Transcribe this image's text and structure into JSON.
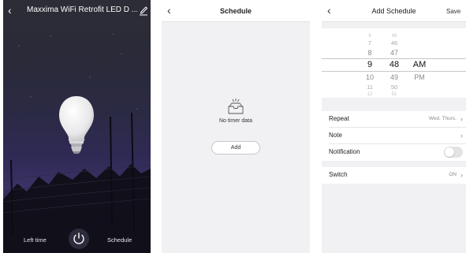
{
  "device_panel": {
    "title": "Maxxima WiFi Retrofit LED D ...",
    "left_time_label": "Left time",
    "schedule_label": "Schedule"
  },
  "schedule_panel": {
    "title": "Schedule",
    "empty_text": "No timer data",
    "add_label": "Add"
  },
  "add_schedule_panel": {
    "title": "Add Schedule",
    "save_label": "Save",
    "picker": {
      "hours": [
        "6",
        "7",
        "8",
        "9",
        "10",
        "11",
        "12"
      ],
      "minutes": [
        "45",
        "46",
        "47",
        "48",
        "49",
        "50",
        "51"
      ],
      "periods": [
        "AM",
        "PM"
      ],
      "selected": {
        "hour": "9",
        "minute": "48",
        "period": "AM"
      }
    },
    "rows": {
      "repeat": {
        "label": "Repeat",
        "value": "Wed. Thurs."
      },
      "note": {
        "label": "Note",
        "value": ""
      },
      "notification": {
        "label": "Notification",
        "on": false
      },
      "switch": {
        "label": "Switch",
        "value": "ON"
      }
    }
  },
  "colors": {
    "sky_top": "#2c2d36",
    "sky_purple": "#3b3266",
    "panel_bg": "#f1f1f3",
    "toggle_off": "#e3e3e6"
  },
  "icons": {
    "back": "chevron-left-icon",
    "edit": "pencil-icon",
    "power": "power-icon",
    "empty": "empty-tray-icon",
    "chevron": "chevron-right-icon"
  }
}
